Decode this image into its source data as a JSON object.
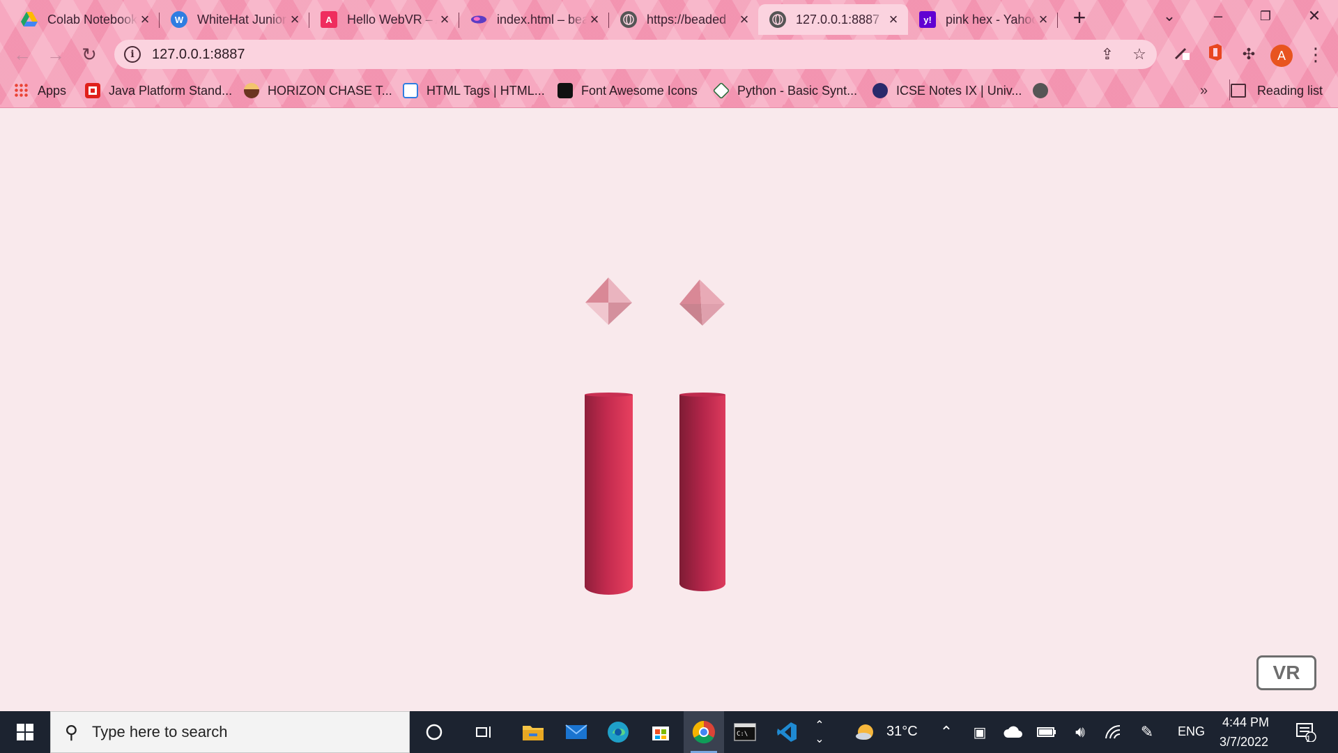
{
  "browser": {
    "tabs": [
      {
        "title": "Colab Notebooks",
        "favicon": "google-drive-icon",
        "color": "#1fa463",
        "active": false
      },
      {
        "title": "WhiteHat Junior",
        "favicon": "whitehat-icon",
        "color": "#2f7de1",
        "active": false
      },
      {
        "title": "Hello WebVR – A-Frame",
        "favicon": "aframe-icon",
        "color": "#ef2d5e",
        "active": false
      },
      {
        "title": "index.html – bead",
        "favicon": "glitch-icon",
        "color": "#5b3cc4",
        "active": false
      },
      {
        "title": "https://beaded",
        "favicon": "globe-icon",
        "color": "#555555",
        "active": false
      },
      {
        "title": "127.0.0.1:8887",
        "favicon": "globe-icon",
        "color": "#555555",
        "active": true
      },
      {
        "title": "pink hex - Yahoo",
        "favicon": "yahoo-icon",
        "color": "#6001d2",
        "active": false
      }
    ],
    "address": "127.0.0.1:8887",
    "bookmarks": [
      {
        "label": "Apps",
        "icon": "apps-grid-icon"
      },
      {
        "label": "Java Platform Stand...",
        "icon": "oracle-icon"
      },
      {
        "label": "HORIZON CHASE T...",
        "icon": "game-icon"
      },
      {
        "label": "HTML Tags | HTML...",
        "icon": "html-icon"
      },
      {
        "label": "Font Awesome Icons",
        "icon": "flag-icon"
      },
      {
        "label": "Python - Basic Synt...",
        "icon": "python-icon"
      },
      {
        "label": "ICSE Notes IX | Univ...",
        "icon": "icse-icon"
      }
    ],
    "more_bookmarks": "»",
    "reading_list": "Reading list",
    "profile_initial": "A"
  },
  "page": {
    "vr_label": "VR",
    "background": "#f9e9ec",
    "cylinder_color": "#dc3a5e",
    "gem_color": "#e8a3b1"
  },
  "taskbar": {
    "search_placeholder": "Type here to search",
    "weather": "31°C",
    "language": "ENG",
    "time": "4:44 PM",
    "date": "3/7/2022",
    "notification_count": "1"
  }
}
